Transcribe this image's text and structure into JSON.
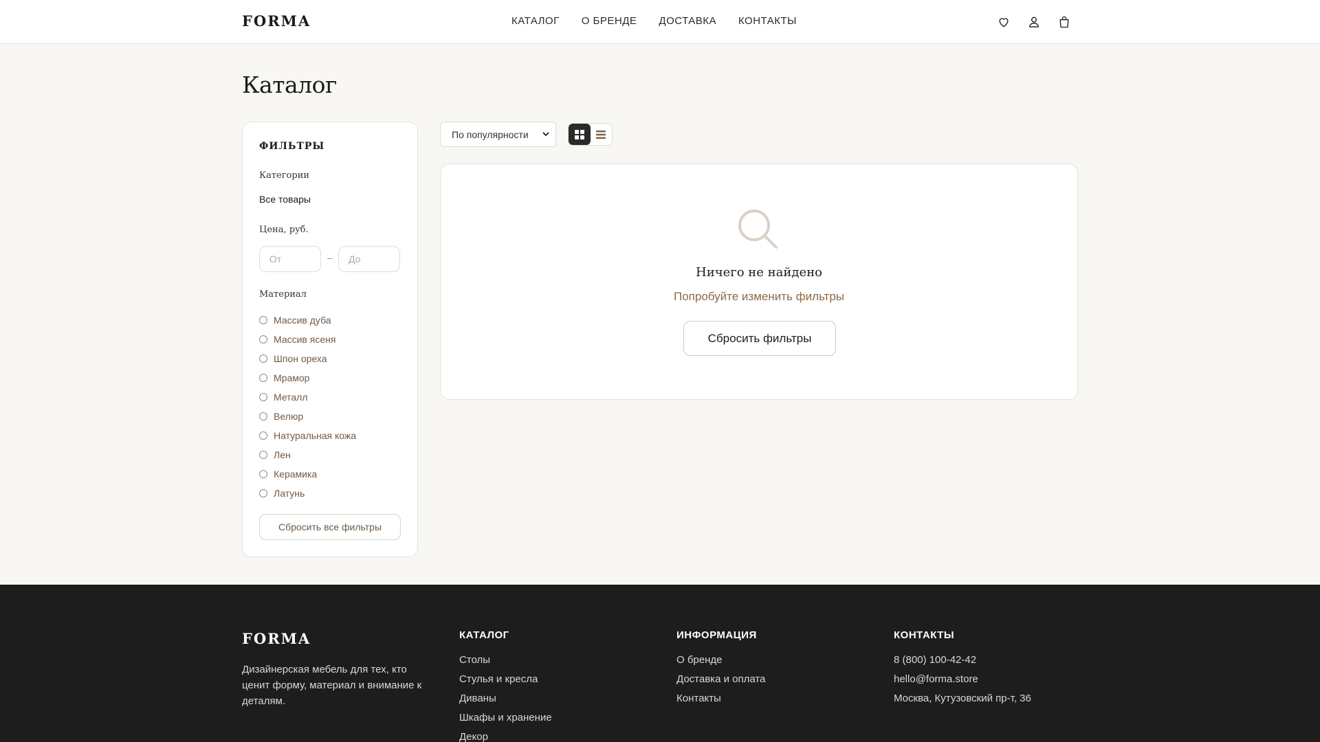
{
  "header": {
    "logo": "FORMA",
    "nav": [
      {
        "label": "КАТАЛОГ"
      },
      {
        "label": "О БРЕНДЕ"
      },
      {
        "label": "ДОСТАВКА"
      },
      {
        "label": "КОНТАКТЫ"
      }
    ],
    "icons": [
      "heart-icon",
      "user-icon",
      "bag-icon"
    ]
  },
  "page": {
    "title": "Каталог"
  },
  "filters": {
    "title": "ФИЛЬТРЫ",
    "categories_label": "Категории",
    "category_selected": "Все товары",
    "price_label": "Цена, руб.",
    "price_from_placeholder": "От",
    "price_to_placeholder": "До",
    "price_separator": "–",
    "material_label": "Материал",
    "materials": [
      {
        "label": "Массив дуба"
      },
      {
        "label": "Массив ясеня"
      },
      {
        "label": "Шпон ореха"
      },
      {
        "label": "Мрамор"
      },
      {
        "label": "Металл"
      },
      {
        "label": "Велюр"
      },
      {
        "label": "Натуральная кожа"
      },
      {
        "label": "Лен"
      },
      {
        "label": "Керамика"
      },
      {
        "label": "Латунь"
      }
    ],
    "reset_all_label": "Сбросить все фильтры"
  },
  "toolbar": {
    "sort_value": "По популярности",
    "view_modes": [
      "grid",
      "list"
    ],
    "active_view": "grid"
  },
  "empty_state": {
    "icon": "search-icon",
    "title": "Ничего не найдено",
    "subtitle": "Попробуйте изменить фильтры",
    "button_label": "Сбросить фильтры"
  },
  "footer": {
    "logo": "FORMA",
    "description": "Дизайнерская мебель для тех, кто ценит форму, материал и внимание к деталям.",
    "columns": [
      {
        "heading": "КАТАЛОГ",
        "links": [
          "Столы",
          "Стулья и кресла",
          "Диваны",
          "Шкафы и хранение",
          "Декор"
        ]
      },
      {
        "heading": "ИНФОРМАЦИЯ",
        "links": [
          "О бренде",
          "Доставка и оплата",
          "Контакты"
        ]
      },
      {
        "heading": "КОНТАКТЫ",
        "links": [
          "8 (800) 100-42-42",
          "hello@forma.store",
          "Москва, Кутузовский пр-т, 36"
        ]
      }
    ]
  },
  "colors": {
    "background": "#f8f7f4",
    "accent_brown": "#8b6a48",
    "footer_bg": "#1d1d1d"
  }
}
